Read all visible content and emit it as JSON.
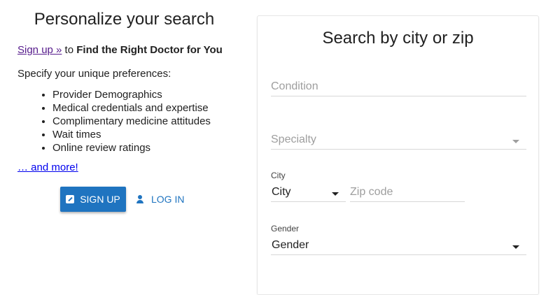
{
  "left": {
    "heading": "Personalize your search",
    "signup_link": "Sign up »",
    "signup_connector": " to ",
    "signup_tagline": "Find the Right Doctor for You",
    "preferences_intro": "Specify your unique preferences:",
    "preferences": [
      "Provider Demographics",
      "Medical credentials and expertise",
      "Complimentary medicine attitudes",
      "Wait times",
      "Online review ratings"
    ],
    "more_link": "… and more!",
    "signup_button": "SIGN UP",
    "login_button": "LOG IN"
  },
  "search": {
    "title": "Search by city or zip",
    "condition_placeholder": "Condition",
    "specialty_placeholder": "Specialty",
    "city_label": "City",
    "city_value": "City",
    "zip_placeholder": "Zip code",
    "gender_label": "Gender",
    "gender_value": "Gender"
  },
  "icons": {
    "signup": "edit-icon",
    "login": "person-icon",
    "dropdown": "caret-down-icon"
  },
  "colors": {
    "primary": "#1f74c0",
    "visited_link": "#551a8b",
    "link": "#0000ee"
  }
}
